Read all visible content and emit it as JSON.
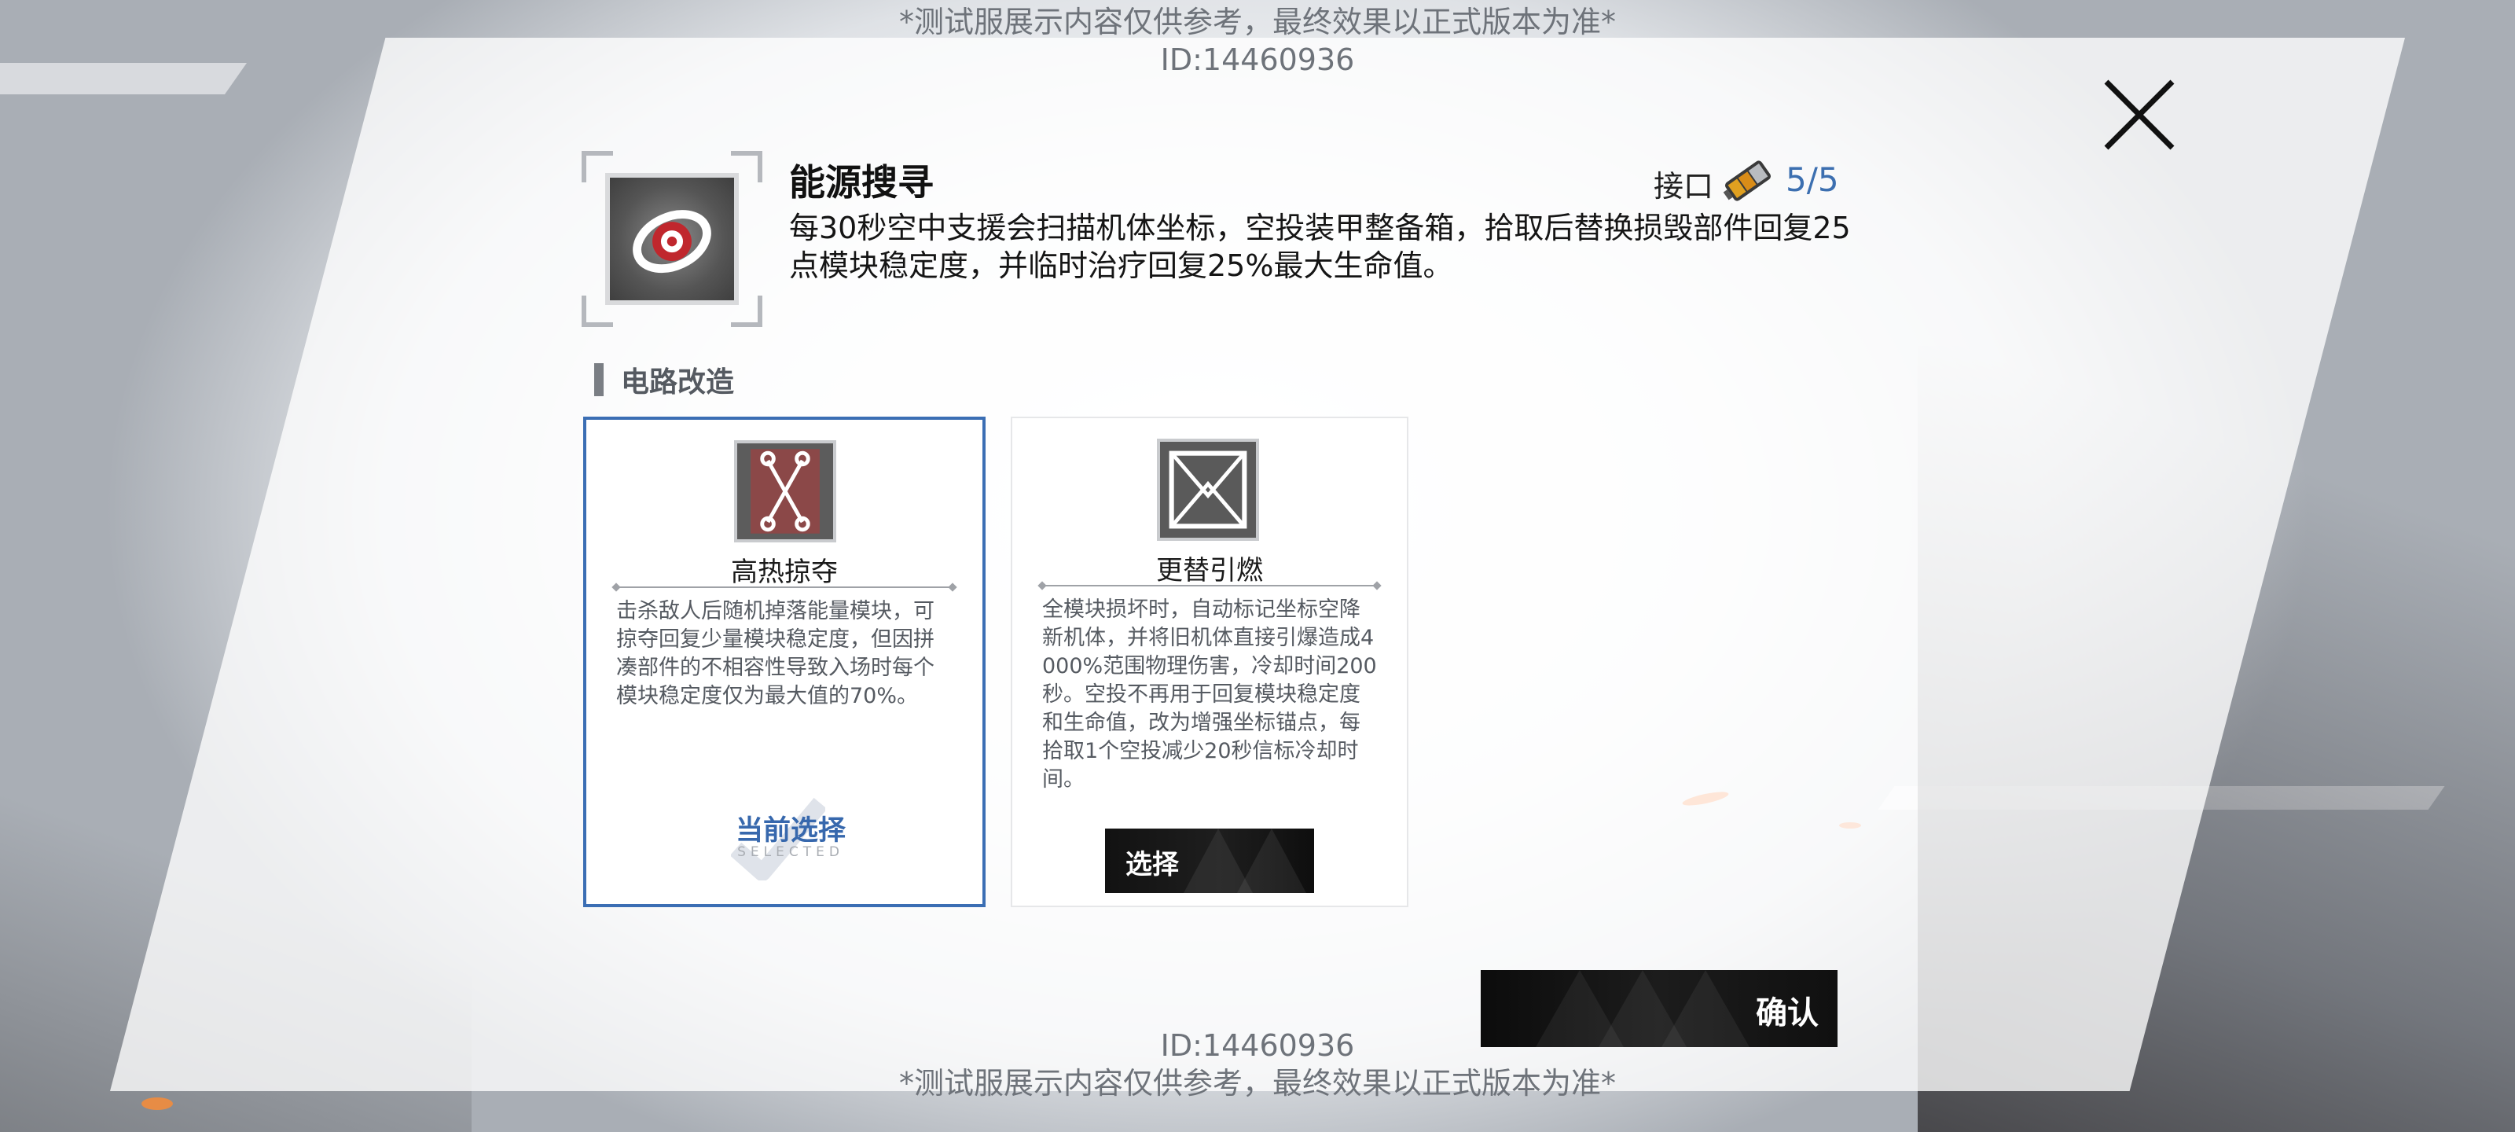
{
  "watermark": {
    "notice": "*测试服展示内容仅供参考，最终效果以正式版本为准*",
    "id": "ID:14460936"
  },
  "skill": {
    "icon": "orbit-eye-icon",
    "title": "能源搜寻",
    "port_label": "接口",
    "port_icon": "battery-chip-icon",
    "port_value": "5/5",
    "description": "每30秒空中支援会扫描机体坐标，空投装甲整备箱，拾取后替换损毁部件回复25点模块稳定度，并临时治疗回复25%最大生命值。"
  },
  "section": {
    "title": "电路改造"
  },
  "cards": [
    {
      "icon": "circuit-cross-icon",
      "title": "高热掠夺",
      "description": "击杀敌人后随机掉落能量模块，可掠夺回复少量模块稳定度，但因拼凑部件的不相容性导致入场时每个模块稳定度仅为最大值的70%。",
      "selected": true,
      "selected_label": "当前选择",
      "selected_sub": "SELECTED"
    },
    {
      "icon": "bowtie-frame-icon",
      "title": "更替引燃",
      "description": "全模块损坏时，自动标记坐标空降新机体，并将旧机体直接引爆造成4000%范围物理伤害，冷却时间200秒。空投不再用于回复模块稳定度和生命值，改为增强坐标锚点，每拾取1个空投减少20秒信标冷却时间。",
      "selected": false,
      "select_label": "选择"
    }
  ],
  "confirm_label": "确认",
  "colors": {
    "accent_blue": "#3b6eb4",
    "button_dark": "#141414",
    "icon_red": "#c0272d"
  }
}
